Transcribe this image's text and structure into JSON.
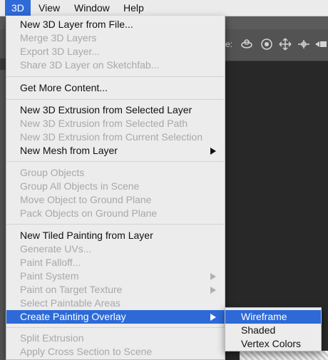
{
  "menubar": {
    "items": [
      {
        "label": "3D",
        "active": true
      },
      {
        "label": "View",
        "active": false
      },
      {
        "label": "Window",
        "active": false
      },
      {
        "label": "Help",
        "active": false
      }
    ]
  },
  "options_bar": {
    "label_fragment": "e:",
    "icons": [
      "rotate-3d-icon",
      "roll-3d-icon",
      "pan-3d-icon",
      "slide-3d-icon",
      "video-camera-icon"
    ]
  },
  "menu": {
    "items": [
      {
        "label": "New 3D Layer from File...",
        "enabled": true
      },
      {
        "label": "Merge 3D Layers",
        "enabled": false
      },
      {
        "label": "Export 3D Layer...",
        "enabled": false
      },
      {
        "label": "Share 3D Layer on Sketchfab...",
        "enabled": false
      },
      {
        "label": "Get More Content...",
        "enabled": true
      },
      {
        "label": "New 3D Extrusion from Selected Layer",
        "enabled": true
      },
      {
        "label": "New 3D Extrusion from Selected Path",
        "enabled": false
      },
      {
        "label": "New 3D Extrusion from Current Selection",
        "enabled": false
      },
      {
        "label": "New Mesh from Layer",
        "enabled": true,
        "submenu": true
      },
      {
        "label": "Group Objects",
        "enabled": false
      },
      {
        "label": "Group All Objects in Scene",
        "enabled": false
      },
      {
        "label": "Move Object to Ground Plane",
        "enabled": false
      },
      {
        "label": "Pack Objects on Ground Plane",
        "enabled": false
      },
      {
        "label": "New Tiled Painting from Layer",
        "enabled": true
      },
      {
        "label": "Generate UVs...",
        "enabled": false
      },
      {
        "label": "Paint Falloff...",
        "enabled": false
      },
      {
        "label": "Paint System",
        "enabled": false,
        "submenu": true
      },
      {
        "label": "Paint on Target Texture",
        "enabled": false,
        "submenu": true
      },
      {
        "label": "Select Paintable Areas",
        "enabled": false
      },
      {
        "label": "Create Painting Overlay",
        "enabled": true,
        "submenu": true,
        "highlighted": true
      },
      {
        "label": "Split Extrusion",
        "enabled": false
      },
      {
        "label": "Apply Cross Section to Scene",
        "enabled": false
      }
    ]
  },
  "submenu": {
    "items": [
      {
        "label": "Wireframe",
        "highlighted": true
      },
      {
        "label": "Shaded",
        "highlighted": false
      },
      {
        "label": "Vertex Colors",
        "highlighted": false
      }
    ]
  },
  "colors": {
    "highlight": "#2d6ad8",
    "menu_background": "#ececec",
    "disabled_text": "#a8a8a8"
  }
}
